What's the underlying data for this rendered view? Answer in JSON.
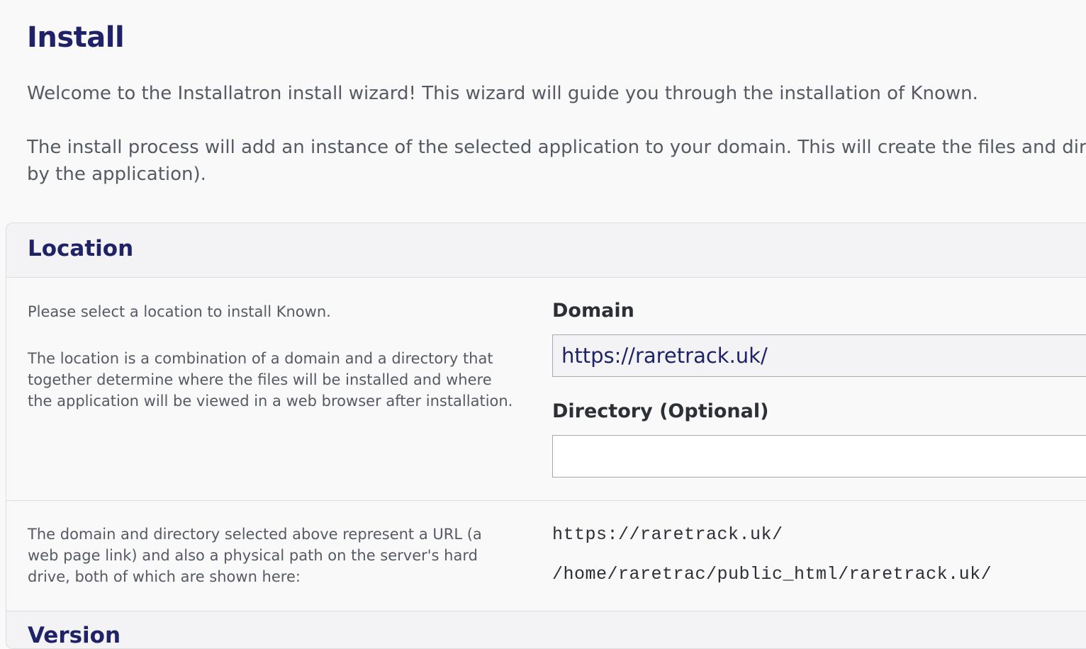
{
  "page": {
    "title": "Install",
    "intro1": "Welcome to the Installatron install wizard! This wizard will guide you through the installation of Known.",
    "intro2": "The install process will add an instance of the selected application to your domain. This will create the files and dire by the application)."
  },
  "location": {
    "heading": "Location",
    "desc1": "Please select a location to install Known.",
    "desc2": "The location is a combination of a domain and a directory that together determine where the files will be installed and where the application will be viewed in a web browser after installation.",
    "domain_label": "Domain",
    "domain_value": "https://raretrack.uk/",
    "directory_label": "Directory (Optional)",
    "directory_value": "",
    "desc3": "The domain and directory selected above represent a URL (a web page link) and also a physical path on the server's hard drive, both of which are shown here:",
    "url": "https://raretrack.uk/",
    "path": "/home/raretrac/public_html/raretrack.uk/"
  },
  "version": {
    "heading": "Version"
  }
}
